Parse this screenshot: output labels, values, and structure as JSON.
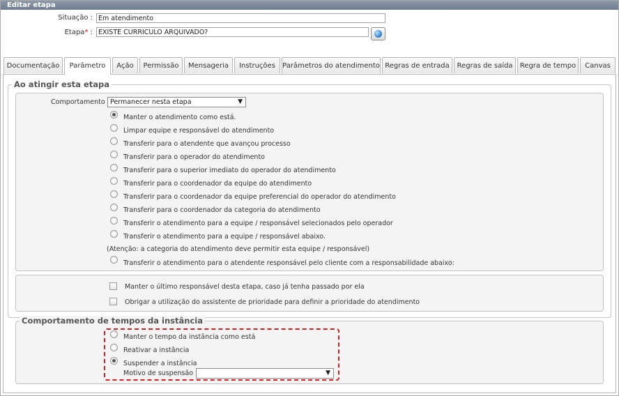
{
  "window": {
    "title": "Editar etapa"
  },
  "form": {
    "situacao_label": "Situação :",
    "situacao_value": "Em atendimento",
    "etapa_label": "Etapa",
    "etapa_required": "*",
    "etapa_colon": " :",
    "etapa_value": "EXISTE CURRICULO ARQUIVADO?"
  },
  "tabs": [
    {
      "label": "Documentação"
    },
    {
      "label": "Parâmetro",
      "active": true
    },
    {
      "label": "Ação"
    },
    {
      "label": "Permissão"
    },
    {
      "label": "Mensageria"
    },
    {
      "label": "Instruções"
    },
    {
      "label": "Parâmetros do atendimento"
    },
    {
      "label": "Regras de entrada"
    },
    {
      "label": "Regras de saída"
    },
    {
      "label": "Regra de tempo"
    },
    {
      "label": "Canvas"
    }
  ],
  "section1": {
    "legend": "Ao atingir esta etapa",
    "comportamento_label": "Comportamento :",
    "comportamento_value": "Permanecer nesta etapa",
    "options": [
      {
        "label": "Manter o atendimento como está.",
        "checked": true
      },
      {
        "label": "Limpar equipe e responsável do atendimento",
        "checked": false
      },
      {
        "label": "Transferir para o atendente que avançou processo",
        "checked": false
      },
      {
        "label": "Transferir para o operador do atendimento",
        "checked": false
      },
      {
        "label": "Transferir para o superior imediato do operador do atendimento",
        "checked": false
      },
      {
        "label": "Transferir para o coordenador da equipe do atendimento",
        "checked": false
      },
      {
        "label": "Transferir para o coordenador da equipe preferencial do operador do atendimento",
        "checked": false
      },
      {
        "label": "Transferir para o coordenador da categoria do atendimento",
        "checked": false
      },
      {
        "label": "Transferir o atendimento para a equipe / responsável selecionados pelo operador",
        "checked": false
      },
      {
        "label": "Transferir o atendimento para a equipe / responsável abaixo.",
        "checked": false
      }
    ],
    "note": "(Atenção: a categoria do atendimento deve permitir esta equipe / responsável)",
    "last_option": {
      "label": "Transferir o atendimento para o atendente responsável pelo cliente com a responsabilidade abaixo:",
      "checked": false
    }
  },
  "section2": {
    "checkboxes": [
      {
        "label": "Manter o último responsável desta etapa, caso já tenha passado por ela",
        "checked": false
      },
      {
        "label": "Obrigar a utilização do assistente de prioridade para definir a prioridade do atendimento",
        "checked": false
      }
    ]
  },
  "section3": {
    "legend": "Comportamento de tempos da instância",
    "options": [
      {
        "label": "Manter o tempo da instância como está",
        "checked": false
      },
      {
        "label": "Reativar a instância",
        "checked": false
      },
      {
        "label": "Suspender a instância",
        "checked": true
      }
    ],
    "motivo_label": "Motivo de suspensão :",
    "motivo_value": ""
  },
  "icons": {
    "etapa_button": "globe-icon",
    "dropdown": "chevron-down-icon"
  },
  "colors": {
    "titlebar": "#7a8696",
    "highlight_border": "#d62020",
    "required": "#dd0000"
  }
}
